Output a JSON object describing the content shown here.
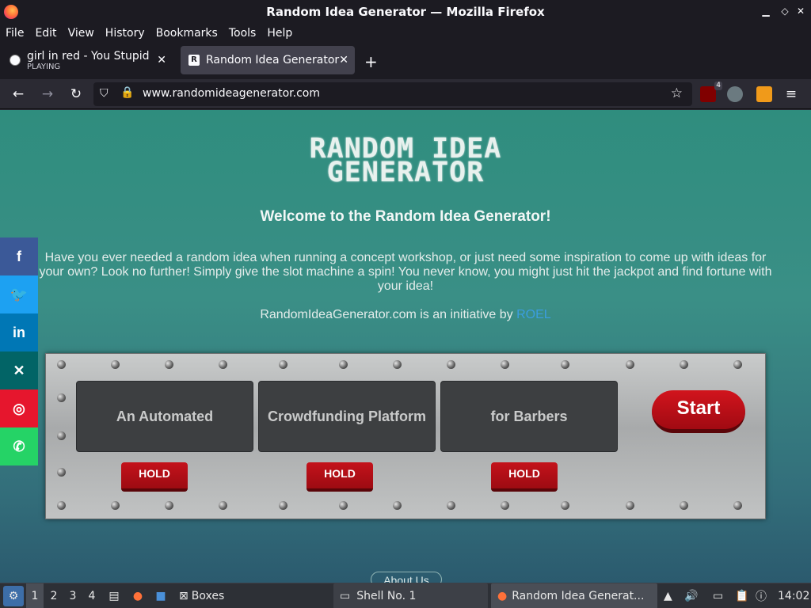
{
  "window": {
    "title": "Random Idea Generator — Mozilla Firefox"
  },
  "menu": [
    "File",
    "Edit",
    "View",
    "History",
    "Bookmarks",
    "Tools",
    "Help"
  ],
  "tabs": [
    {
      "title": "girl in red - You Stupid Bi",
      "subtitle": "PLAYING",
      "favicon": "music-note-icon"
    },
    {
      "title": "Random Idea Generator",
      "favicon": "r-icon"
    }
  ],
  "nav": {
    "url": "www.randomideagenerator.com",
    "ext_badge": "4"
  },
  "page": {
    "logo_line1": "RANDOM IDEA",
    "logo_line2": "GENERATOR",
    "welcome": "Welcome to the Random Idea Generator!",
    "intro": "Have you ever needed a random idea when running a concept workshop, or just need some inspiration to come up with ideas for your own? Look no further! Simply give the slot machine a spin! You never know, you might just hit the jackpot and find fortune with your idea!",
    "initiative_text": "RandomIdeaGenerator.com is an initiative by ",
    "initiative_link": "ROEL",
    "slots": [
      "An Automated",
      "Crowdfunding Platform",
      "for Barbers"
    ],
    "hold_label": "HOLD",
    "start_label": "Start",
    "about": "About Us"
  },
  "social": [
    {
      "icon": "facebook-icon",
      "glyph": "f",
      "color": "#3b5998"
    },
    {
      "icon": "twitter-icon",
      "glyph": "🐦",
      "color": "#1da1f2"
    },
    {
      "icon": "linkedin-icon",
      "glyph": "in",
      "color": "#0077b5"
    },
    {
      "icon": "xing-icon",
      "glyph": "✕",
      "color": "#026466"
    },
    {
      "icon": "weibo-icon",
      "glyph": "◎",
      "color": "#e6162d"
    },
    {
      "icon": "whatsapp-icon",
      "glyph": "✆",
      "color": "#25d366"
    }
  ],
  "taskbar": {
    "workspaces": [
      "1",
      "2",
      "3",
      "4"
    ],
    "boxes_label": "Boxes",
    "shell_label": "Shell No. 1",
    "firefox_label": "Random Idea Generat...",
    "clock": "14:02"
  },
  "colors": {
    "accent_red": "#c4121b",
    "link_blue": "#3a9ee0",
    "browser_bg": "#1c1b22"
  }
}
